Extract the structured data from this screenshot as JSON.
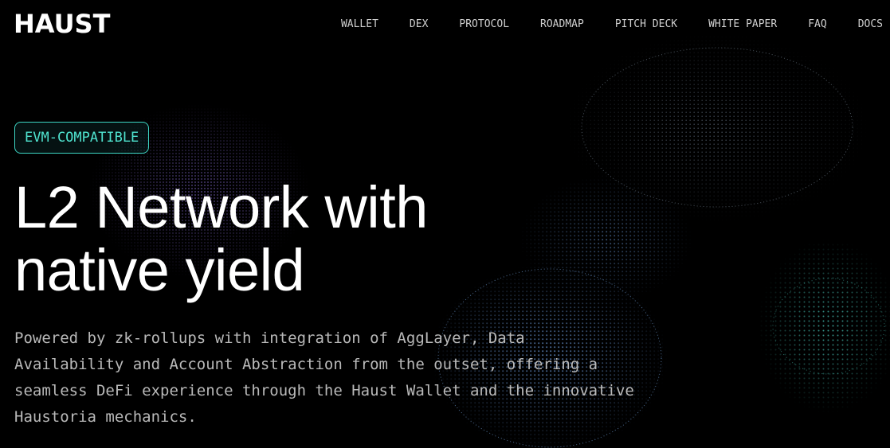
{
  "brand": {
    "logo": "HAUST"
  },
  "nav": {
    "items": [
      {
        "label": "WALLET"
      },
      {
        "label": "DEX"
      },
      {
        "label": "PROTOCOL"
      },
      {
        "label": "ROADMAP"
      },
      {
        "label": "PITCH DECK"
      },
      {
        "label": "WHITE PAPER"
      },
      {
        "label": "FAQ"
      },
      {
        "label": "DOCS"
      }
    ]
  },
  "hero": {
    "badge": "EVM-COMPATIBLE",
    "headline": "L2 Network with native yield",
    "description": "Powered by zk-rollups with integration of AggLayer, Data Availability and Account Abstraction from the outset, offering a seamless DeFi experience through the Haust Wallet and the innovative Haustoria mechanics."
  },
  "colors": {
    "background": "#000000",
    "accent": "#4fe3cf",
    "text": "#ffffff",
    "muted_text": "#b9b9b9"
  }
}
